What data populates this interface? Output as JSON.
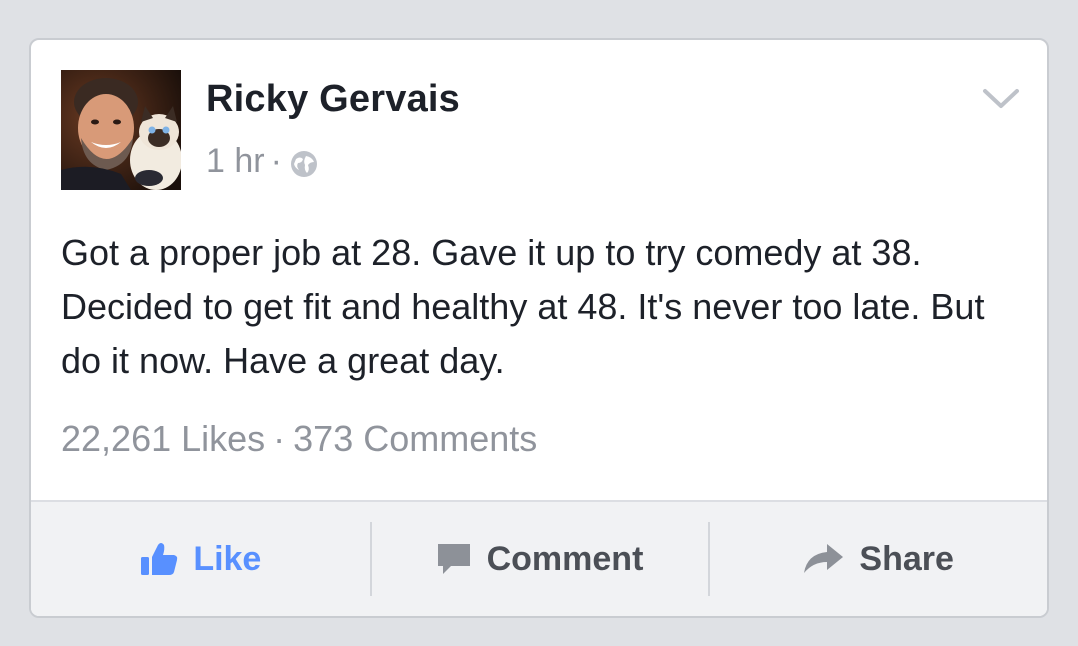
{
  "post": {
    "author": "Ricky Gervais",
    "time": "1 hr",
    "separator": "·",
    "privacy_icon": "globe-icon",
    "text": "Got a proper job at 28. Gave it up to try comedy at 38. Decided to get fit and healthy at 48. It's never too late. But do it now. Have a great day.",
    "likes": "22,261 Likes",
    "comments": "373 Comments",
    "stats_separator": "·"
  },
  "actions": {
    "like": "Like",
    "comment": "Comment",
    "share": "Share"
  },
  "colors": {
    "accent": "#5890ff",
    "text": "#1d2129",
    "muted": "#90949c"
  }
}
